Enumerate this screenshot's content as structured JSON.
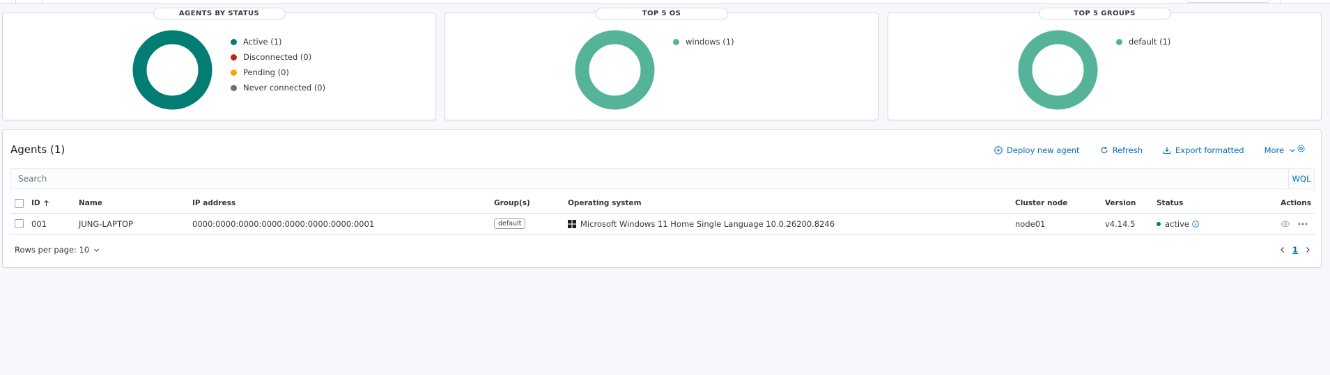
{
  "colors": {
    "active": "#017d73",
    "disconnected": "#bd271e",
    "pending": "#f5a700",
    "never_connected": "#69707d",
    "os_donut": "#54b399",
    "link": "#006bb8"
  },
  "panels": {
    "status": {
      "title": "AGENTS BY STATUS",
      "legend": [
        "Active (1)",
        "Disconnected (0)",
        "Pending (0)",
        "Never connected (0)"
      ]
    },
    "os": {
      "title": "TOP 5 OS",
      "legend": [
        "windows (1)"
      ]
    },
    "groups": {
      "title": "TOP 5 GROUPS",
      "legend": [
        "default (1)"
      ]
    }
  },
  "chart_data": [
    {
      "type": "pie",
      "title": "AGENTS BY STATUS",
      "categories": [
        "Active",
        "Disconnected",
        "Pending",
        "Never connected"
      ],
      "values": [
        1,
        0,
        0,
        0
      ],
      "colors": [
        "#017d73",
        "#bd271e",
        "#f5a700",
        "#69707d"
      ],
      "legend": "right"
    },
    {
      "type": "pie",
      "title": "TOP 5 OS",
      "categories": [
        "windows"
      ],
      "values": [
        1
      ],
      "colors": [
        "#54b399"
      ],
      "legend": "right"
    },
    {
      "type": "pie",
      "title": "TOP 5 GROUPS",
      "categories": [
        "default"
      ],
      "values": [
        1
      ],
      "colors": [
        "#54b399"
      ],
      "legend": "right"
    }
  ],
  "agents": {
    "title": "Agents (1)",
    "actions": {
      "deploy": "Deploy new agent",
      "refresh": "Refresh",
      "export": "Export formatted",
      "more": "More"
    },
    "search": {
      "placeholder": "Search",
      "value": "",
      "wql": "WQL"
    },
    "columns": {
      "id": "ID",
      "name": "Name",
      "ip": "IP address",
      "groups": "Group(s)",
      "os": "Operating system",
      "cluster": "Cluster node",
      "version": "Version",
      "status": "Status",
      "actions": "Actions"
    },
    "rows": [
      {
        "id": "001",
        "name": "JUNG-LAPTOP",
        "ip": "0000:0000:0000:0000:0000:0000:0000:0001",
        "group": "default",
        "os": "Microsoft Windows 11 Home Single Language 10.0.26200.8246",
        "cluster": "node01",
        "version": "v4.14.5",
        "status": "active"
      }
    ],
    "pagination": {
      "rows_per_page": "Rows per page: 10",
      "current_page": "1"
    }
  }
}
